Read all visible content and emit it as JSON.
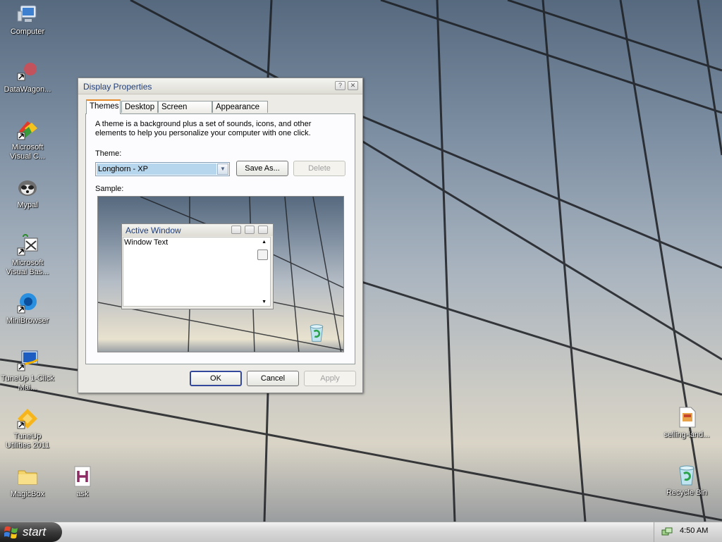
{
  "desktop": {
    "icons": [
      {
        "label": "Computer"
      },
      {
        "label": "DataWagon..."
      },
      {
        "label": "Microsoft Visual C..."
      },
      {
        "label": "Mypal"
      },
      {
        "label": "Microsoft Visual Bas..."
      },
      {
        "label": "MiniBrowser"
      },
      {
        "label": "TuneUp 1-Click Mai..."
      },
      {
        "label": "TuneUp Utilities 2011"
      },
      {
        "label": "MagicBox"
      },
      {
        "label": "ask"
      },
      {
        "label": "selling-land..."
      },
      {
        "label": "Recycle Bin"
      }
    ]
  },
  "dialog": {
    "title": "Display Properties",
    "tabs": [
      "Themes",
      "Desktop",
      "Screen Saver",
      "Appearance"
    ],
    "description": "A theme is a background plus a set of sounds, icons, and other elements to help you personalize your computer with one click.",
    "theme_label": "Theme:",
    "theme_value": "Longhorn - XP",
    "save_as": "Save As...",
    "delete": "Delete",
    "sample_label": "Sample:",
    "sample": {
      "window_title": "Active Window",
      "window_text": "Window Text"
    },
    "ok": "OK",
    "cancel": "Cancel",
    "apply": "Apply"
  },
  "taskbar": {
    "start": "start",
    "clock": "4:50 AM"
  }
}
